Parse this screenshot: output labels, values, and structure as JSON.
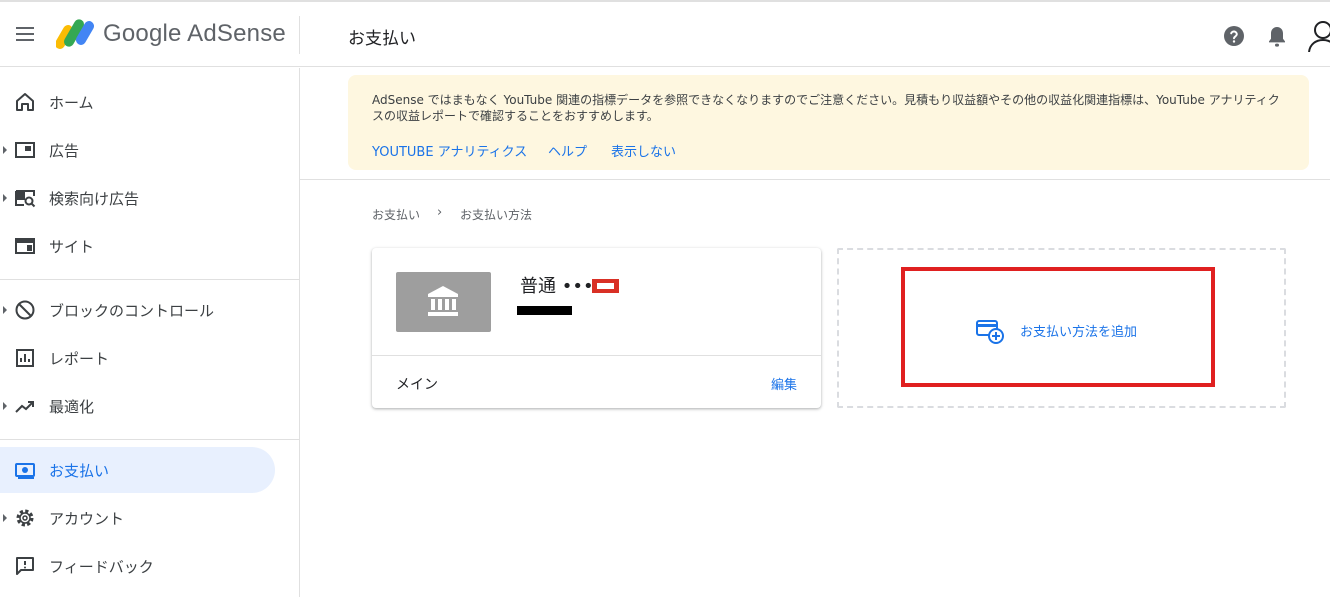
{
  "header": {
    "brand": "Google AdSense",
    "title": "お支払い"
  },
  "sidebar": {
    "items": [
      {
        "label": "ホーム",
        "icon": "home-icon",
        "has_caret": false
      },
      {
        "label": "広告",
        "icon": "ads-icon",
        "has_caret": true
      },
      {
        "label": "検索向け広告",
        "icon": "search-ads-icon",
        "has_caret": true
      },
      {
        "label": "サイト",
        "icon": "sites-icon",
        "has_caret": false
      },
      {
        "label": "ブロックのコントロール",
        "icon": "block-icon",
        "has_caret": true
      },
      {
        "label": "レポート",
        "icon": "reports-icon",
        "has_caret": false
      },
      {
        "label": "最適化",
        "icon": "trending-up-icon",
        "has_caret": true
      },
      {
        "label": "お支払い",
        "icon": "payments-icon",
        "has_caret": false,
        "active": true
      },
      {
        "label": "アカウント",
        "icon": "gear-icon",
        "has_caret": true
      },
      {
        "label": "フィードバック",
        "icon": "feedback-icon",
        "has_caret": false
      }
    ]
  },
  "banner": {
    "text": "AdSense ではまもなく YouTube 関連の指標データを参照できなくなりますのでご注意ください。見積もり収益額やその他の収益化関連指標は、YouTube アナリティクスの収益レポートで確認することをおすすめします。",
    "links": [
      "YOUTUBE アナリティクス",
      "ヘルプ",
      "表示しない"
    ]
  },
  "breadcrumb": {
    "items": [
      "お支払い",
      "お支払い方法"
    ],
    "separator": "›"
  },
  "payment_card": {
    "bank_name": "普通 ••••",
    "label": "メイン",
    "edit": "編集"
  },
  "add_payment": {
    "label": "お支払い方法を追加"
  },
  "colors": {
    "accent": "#1a73e8",
    "banner_bg": "#fef7e0",
    "highlight": "#e02020",
    "active_nav_bg": "#e8f0fe"
  }
}
